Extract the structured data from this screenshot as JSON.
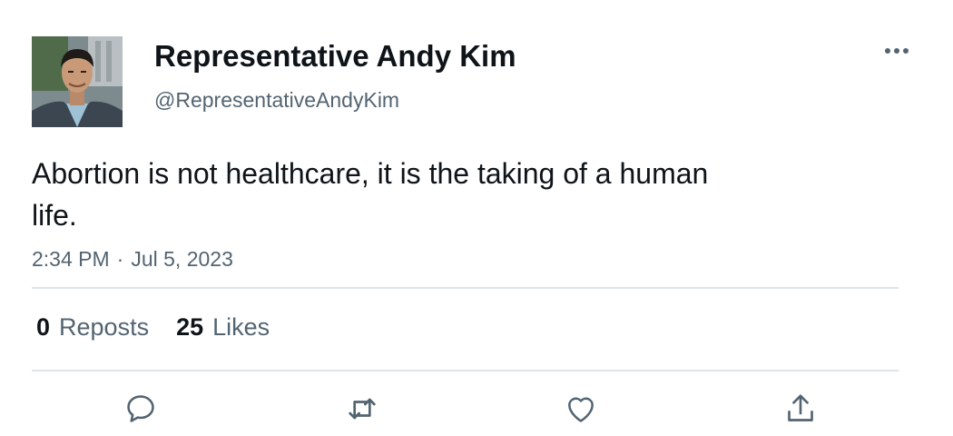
{
  "tweet": {
    "author": {
      "display_name": "Representative Andy Kim",
      "handle": "@RepresentativeAndyKim"
    },
    "text": "Abortion is not healthcare, it is the taking of a human life.",
    "time": "2:34 PM",
    "separator": "·",
    "date": "Jul 5, 2023",
    "stats": {
      "reposts_count": "0",
      "reposts_label": "Reposts",
      "likes_count": "25",
      "likes_label": "Likes"
    },
    "icons": {
      "more": "more-horizontal-icon",
      "reply": "reply-icon",
      "repost": "repost-icon",
      "like": "heart-icon",
      "share": "share-icon"
    }
  },
  "colors": {
    "text": "#0f1419",
    "secondary": "#536471",
    "divider": "#dfe3e6",
    "icon": "#536471"
  }
}
